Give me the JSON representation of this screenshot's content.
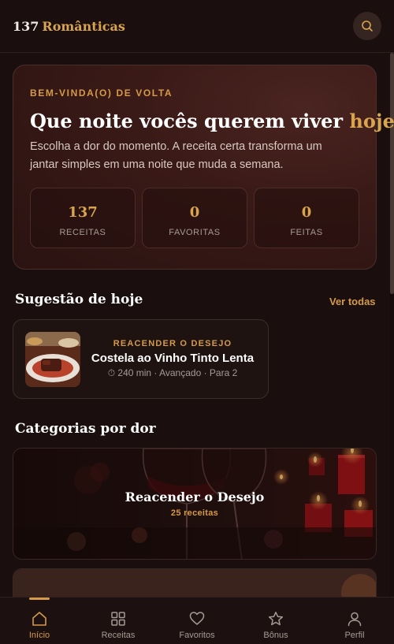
{
  "header": {
    "brand_number": "137",
    "brand_word": "Românticas",
    "search_icon": "search-icon"
  },
  "hero": {
    "kicker": "BEM-VINDA(O) DE VOLTA",
    "title_prefix": "Que noite vocês querem viver ",
    "title_accent": "hoje",
    "title_suffix": "?",
    "subtitle": "Escolha a dor do momento. A receita certa transforma um jantar simples em uma noite que muda a semana.",
    "stats": [
      {
        "value": "137",
        "label": "RECEITAS"
      },
      {
        "value": "0",
        "label": "FAVORITAS"
      },
      {
        "value": "0",
        "label": "FEITAS"
      }
    ]
  },
  "suggestion": {
    "section_title": "Sugestão de hoje",
    "see_all": "Ver todas",
    "card": {
      "category": "REACENDER O DESEJO",
      "title": "Costela ao Vinho Tinto Lenta",
      "meta": "⏱ 240 min · Avançado · Para 2"
    }
  },
  "categories": {
    "section_title": "Categorias por dor",
    "items": [
      {
        "name": "Reacender o Desejo",
        "count": "25 receitas"
      }
    ]
  },
  "nav": {
    "items": [
      {
        "label": "Início",
        "icon": "home-icon",
        "active": true
      },
      {
        "label": "Receitas",
        "icon": "grid-icon",
        "active": false
      },
      {
        "label": "Favoritos",
        "icon": "heart-icon",
        "active": false
      },
      {
        "label": "Bônus",
        "icon": "star-icon",
        "active": false
      },
      {
        "label": "Perfil",
        "icon": "user-icon",
        "active": false
      }
    ]
  },
  "colors": {
    "background": "#1a0f0e",
    "accent": "#d9a44f",
    "hero_bg": "#3a1a17"
  }
}
